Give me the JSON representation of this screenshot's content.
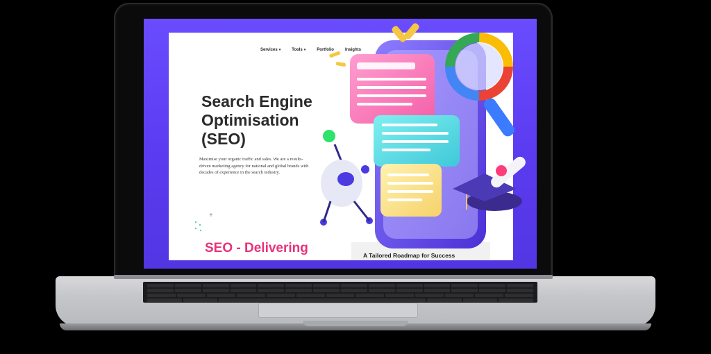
{
  "nav": {
    "items": [
      {
        "label": "Services",
        "caret": "▾"
      },
      {
        "label": "Tools",
        "caret": "▾"
      },
      {
        "label": "Portfolio",
        "caret": ""
      },
      {
        "label": "Insights",
        "caret": ""
      }
    ]
  },
  "hero": {
    "title": "Search Engine Optimisation (SEO)",
    "description": "Maximise your organic traffic and sales. We are a results-driven marketing agency for national and global brands with decades of experience in the search industry."
  },
  "section": {
    "heading": "SEO - Delivering",
    "card_title": "A Tailored Roadmap for Success"
  },
  "colors": {
    "accent_pink": "#e8327a",
    "screen_purple": "#5b3bef"
  }
}
